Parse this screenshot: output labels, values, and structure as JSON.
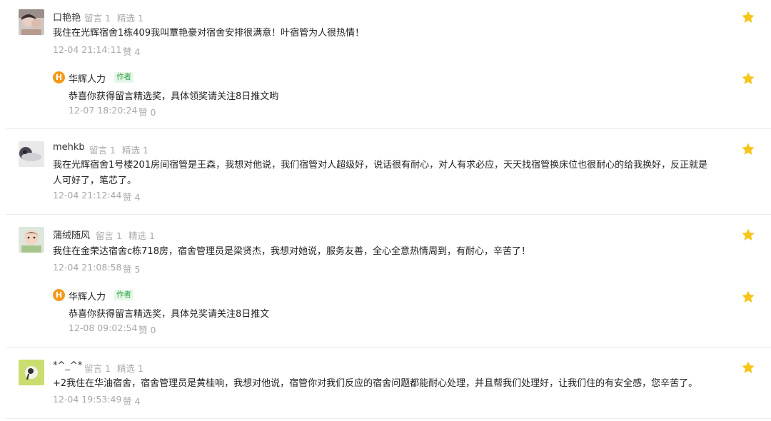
{
  "colors": {
    "star": "#f5c518",
    "author_logo": "#f39a1a",
    "author_badge": "#2aa13c"
  },
  "comments": [
    {
      "name": "口艳艳",
      "messages_label": "留言 1",
      "selected_label": "精选 1",
      "text": "我住在光辉宿舍1栋409我叫覃艳豪对宿舍安排很满意！叶宿管为人很热情！",
      "time": "12-04 21:14:11",
      "likes": "赞 4",
      "star_icon": "star-icon",
      "reply": {
        "name": "华辉人力",
        "badge": "作者",
        "text": "恭喜你获得留言精选奖，具体领奖请关注8日推文哟",
        "time": "12-07 18:20:24",
        "likes": "赞 0"
      }
    },
    {
      "name": "mehkb",
      "messages_label": "留言 1",
      "selected_label": "精选 1",
      "text": "我在光辉宿舍1号楼201房间宿管是王森，我想对他说，我们宿管对人超级好，说话很有耐心，对人有求必应，天天找宿管换床位也很耐心的给我换好，反正就是人可好了，笔芯了。",
      "time": "12-04 21:12:44",
      "likes": "赞 4",
      "star_icon": "star-icon"
    },
    {
      "name": "蒲绒随风",
      "messages_label": "留言 1",
      "selected_label": "精选 1",
      "text": "我住在金荣达宿舍c栋718房，宿舍管理员是梁贤杰，我想对她说，服务友善，全心全意热情周到，有耐心，辛苦了！",
      "time": "12-04 21:08:58",
      "likes": "赞 5",
      "star_icon": "star-icon",
      "reply": {
        "name": "华辉人力",
        "badge": "作者",
        "text": "恭喜你获得留言精选奖，具体兑奖请关注8日推文",
        "time": "12-08 09:02:54",
        "likes": "赞 0"
      }
    },
    {
      "name": "*^_^*",
      "messages_label": "留言 1",
      "selected_label": "精选 1",
      "text": "+2我住在华油宿舍，宿舍管理员是黄桂响，我想对他说，宿管你对我们反应的宿舍问题都能耐心处理，并且帮我们处理好，让我们住的有安全感，您辛苦了。",
      "time": "12-04 19:53:49",
      "likes": "赞 4",
      "star_icon": "star-icon"
    }
  ]
}
